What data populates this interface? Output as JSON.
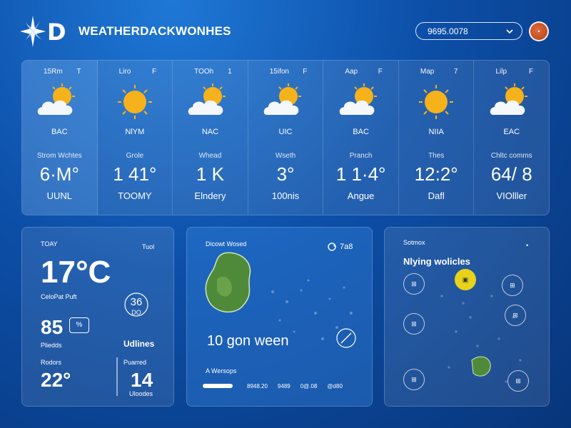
{
  "header": {
    "logo_text": "D",
    "app_title": "WEATHERDACKWONHES",
    "search_value": "9695.0078",
    "avatar_label": "•"
  },
  "forecast": [
    {
      "head_left": "15Rm",
      "head_right": "T",
      "icon": "sun-cloud-icon",
      "cond": "BAC",
      "label": "Strom Wchtes",
      "temp": "6·M°",
      "foot": "UUNL"
    },
    {
      "head_left": "Liro",
      "head_right": "F",
      "icon": "sun-icon",
      "cond": "NlYM",
      "label": "Grole",
      "temp": "1 41°",
      "foot": "TOOMY"
    },
    {
      "head_left": "TOOh",
      "head_right": "1",
      "icon": "sun-cloud-icon",
      "cond": "NAC",
      "label": "Whead",
      "temp": "1 K",
      "foot": "Elndery"
    },
    {
      "head_left": "15ifon",
      "head_right": "F",
      "icon": "sun-cloud-icon",
      "cond": "UIC",
      "label": "Wseth",
      "temp": "3°",
      "foot": "100nis"
    },
    {
      "head_left": "Aap",
      "head_right": "F",
      "icon": "sun-cloud-icon",
      "cond": "BAC",
      "label": "Pranch",
      "temp": "1 1·4°",
      "foot": "Angue"
    },
    {
      "head_left": "Map",
      "head_right": "7",
      "icon": "sun-icon",
      "cond": "NIIA",
      "label": "Thes",
      "temp": "12:2°",
      "foot": "Dafl"
    },
    {
      "head_left": "Lilp",
      "head_right": "F",
      "icon": "sun-cloud-icon",
      "cond": "EAC",
      "label": "Chltc comms",
      "temp": "64/ 8",
      "foot": "VIOlller"
    }
  ],
  "today": {
    "label": "TOAY",
    "corner": "Tuol",
    "temp": "17°C",
    "feels": "CeloPat Puft",
    "gauge_top": "36",
    "gauge_bottom": "DO",
    "humidity": "85",
    "humidity_unit": "%",
    "label_a": "Pliedds",
    "label_b": "Udlines",
    "label_c": "Rodors",
    "label_d": "Puarred",
    "low": "22°",
    "value_d": "14",
    "value_d_sub": "Uloodes"
  },
  "map_card": {
    "title": "Dicowt Wosed",
    "badge": "7a8",
    "headline": "10 gon ween",
    "caption": "A Wersops",
    "timeline": [
      "8948.20",
      "9489",
      "0@.08",
      "@d80"
    ]
  },
  "vehicles_card": {
    "corner": "Sotmox",
    "title": "Nlying wolicles"
  },
  "colors": {
    "accent": "#1f78d6",
    "sun": "#f6b21b",
    "land": "#4f8a3a"
  }
}
